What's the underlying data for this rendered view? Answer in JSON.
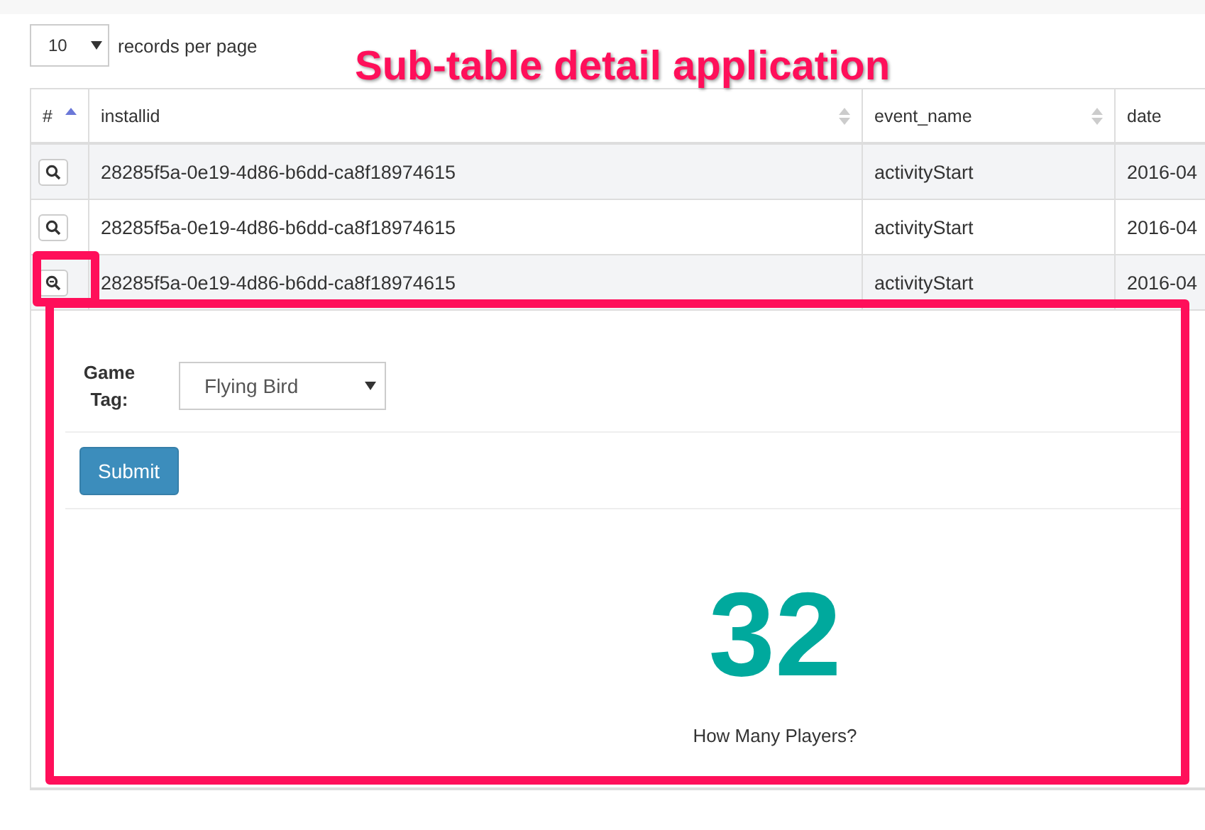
{
  "length_menu": {
    "value": "10",
    "label": "records per page"
  },
  "annotation": {
    "title": "Sub-table detail application"
  },
  "table": {
    "columns": [
      {
        "label": "#",
        "sorted_ascending": true
      },
      {
        "label": "installid",
        "sorted_ascending": false
      },
      {
        "label": "event_name",
        "sorted_ascending": false
      },
      {
        "label": "date"
      }
    ],
    "rows": [
      {
        "expanded": false,
        "cells": [
          "",
          "28285f5a-0e19-4d86-b6dd-ca8f18974615",
          "activityStart",
          "2016-04"
        ]
      },
      {
        "expanded": false,
        "cells": [
          "",
          "28285f5a-0e19-4d86-b6dd-ca8f18974615",
          "activityStart",
          "2016-04"
        ]
      },
      {
        "expanded": true,
        "cells": [
          "",
          "28285f5a-0e19-4d86-b6dd-ca8f18974615",
          "activityStart",
          "2016-04"
        ]
      }
    ]
  },
  "detail": {
    "field_label": "Game Tag:",
    "select_value": "Flying Bird",
    "submit": "Submit",
    "metric_value": "32",
    "metric_label": "How Many Players?"
  }
}
